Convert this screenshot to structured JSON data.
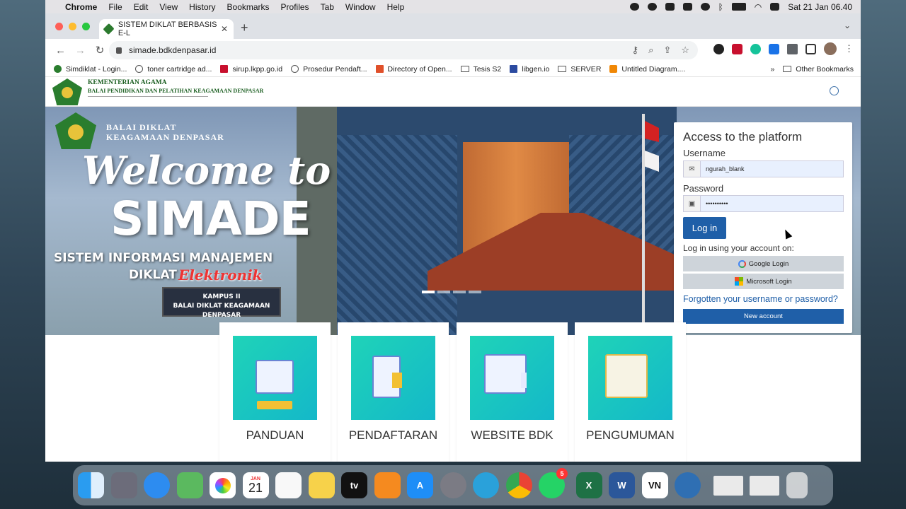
{
  "menubar": {
    "app": "Chrome",
    "items": [
      "File",
      "Edit",
      "View",
      "History",
      "Bookmarks",
      "Profiles",
      "Tab",
      "Window",
      "Help"
    ],
    "datetime": "Sat 21 Jan  06.40"
  },
  "browser": {
    "tab_title": "SISTEM DIKLAT BERBASIS E-L",
    "url": "simade.bdkdenpasar.id",
    "bookmarks": [
      {
        "label": "Simdiklat - Login...",
        "icon": "green-emblem-icon"
      },
      {
        "label": "toner cartridge ad...",
        "icon": "globe-icon"
      },
      {
        "label": "sirup.lkpp.go.id",
        "icon": "red-arrow-icon"
      },
      {
        "label": "Prosedur Pendaft...",
        "icon": "globe-icon"
      },
      {
        "label": "Directory of Open...",
        "icon": "book-icon"
      },
      {
        "label": "Tesis S2",
        "icon": "folder-icon"
      },
      {
        "label": "libgen.io",
        "icon": "libgen-icon"
      },
      {
        "label": "SERVER",
        "icon": "folder-icon"
      },
      {
        "label": "Untitled Diagram....",
        "icon": "drawio-icon"
      }
    ],
    "overflow": "»",
    "other_bookmarks": "Other Bookmarks"
  },
  "site": {
    "org_title": "KEMENTERIAN AGAMA",
    "org_subtitle": "BALAI PENDIDIKAN DAN PELATIHAN KEAGAMAAN DENPASAR"
  },
  "hero": {
    "balai_line1": "BALAI DIKLAT",
    "balai_line2": "KEAGAMAAN DENPASAR",
    "welcome": "Welcome to",
    "simade": "SIMADE",
    "system_line1": "SISTEM INFORMASI MANAJEMEN",
    "system_line2": "DIKLAT",
    "system_italic": "Elektronik",
    "sign_line1": "KAMPUS II",
    "sign_line2": "BALAI DIKLAT KEAGAMAAN DENPASAR"
  },
  "login": {
    "title": "Access to the platform",
    "username_label": "Username",
    "username_value": "ngurah_blank",
    "password_label": "Password",
    "password_value": "••••••••••",
    "login_button": "Log in",
    "using_text": "Log in using your account on:",
    "google_label": "Google Login",
    "microsoft_label": "Microsoft Login",
    "forgot_link": "Forgotten your username or password?",
    "new_account": "New account"
  },
  "cards": [
    "PANDUAN",
    "PENDAFTARAN",
    "WEBSITE BDK",
    "PENGUMUMAN"
  ],
  "dock": {
    "calendar_month": "JAN",
    "calendar_day": "21",
    "whatsapp_badge": "5",
    "appletv_label": "tv",
    "vn_label": "VN"
  },
  "colors": {
    "primary": "#1f5fa8",
    "accent_green": "#2a7d2e"
  }
}
